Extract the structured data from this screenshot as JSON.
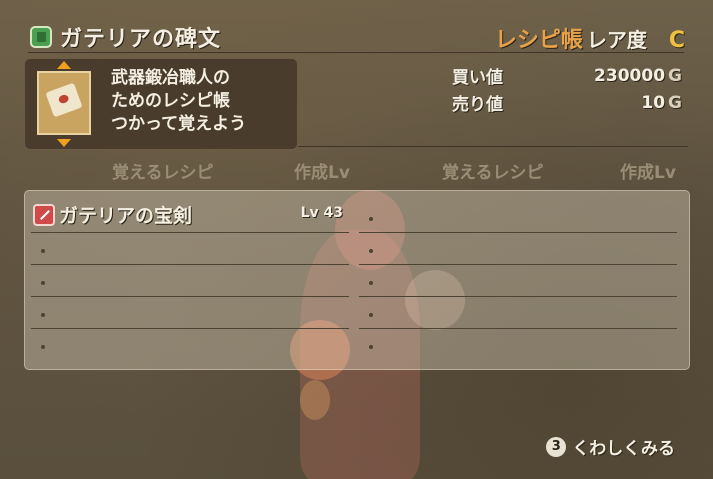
{
  "header": {
    "title": "ガテリアの碑文",
    "rarity_prefix": "レシピ帳",
    "rarity_label": "レア度",
    "rarity_grade": "C"
  },
  "description": {
    "lines": [
      "武器鍛冶職人の",
      "ためのレシピ帳",
      "つかって覚えよう"
    ]
  },
  "prices": {
    "buy_label": "買い値",
    "buy_value": "230000",
    "sell_label": "売り値",
    "sell_value": "10",
    "currency": "G"
  },
  "columns": {
    "recipe_left": "覚えるレシピ",
    "level_left": "作成Lv",
    "recipe_right": "覚えるレシピ",
    "level_right": "作成Lv"
  },
  "recipes": [
    {
      "name": "ガテリアの宝剣",
      "level": "Lv 43"
    }
  ],
  "footer": {
    "button_glyph": "3",
    "action_label": "くわしくみる"
  },
  "colors": {
    "accent_orange": "#e8a24a",
    "grade_yellow": "#f0c040",
    "text_light": "#f4efe2"
  }
}
